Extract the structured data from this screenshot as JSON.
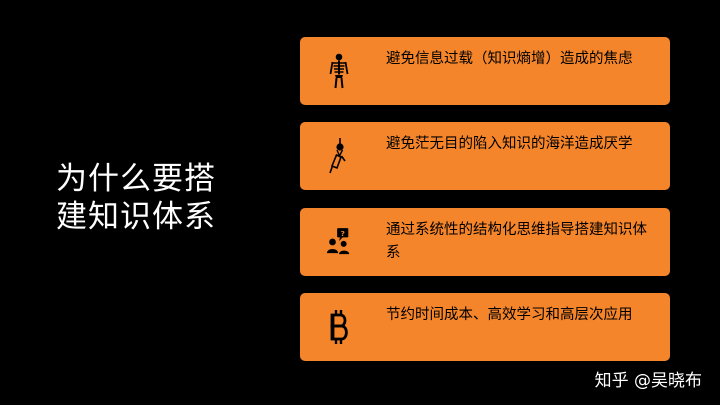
{
  "title": {
    "line1": "为什么要搭",
    "line2": "建知识体系"
  },
  "items": [
    {
      "icon": "skeleton-icon",
      "text": "避免信息过载（知识熵增）造成的焦虑"
    },
    {
      "icon": "tied-knot-icon",
      "text": "避免茫无目的陷入知识的海洋造成厌学"
    },
    {
      "icon": "people-question-icon",
      "text": "通过系统性的结构化思维指导搭建知识体系"
    },
    {
      "icon": "bitcoin-icon",
      "text": "节约时间成本、高效学习和高层次应用"
    }
  ],
  "watermark": "知乎 @吴晓布",
  "colors": {
    "background": "#000000",
    "card": "#f5852a",
    "title": "#ffffff",
    "card_text": "#000000"
  }
}
